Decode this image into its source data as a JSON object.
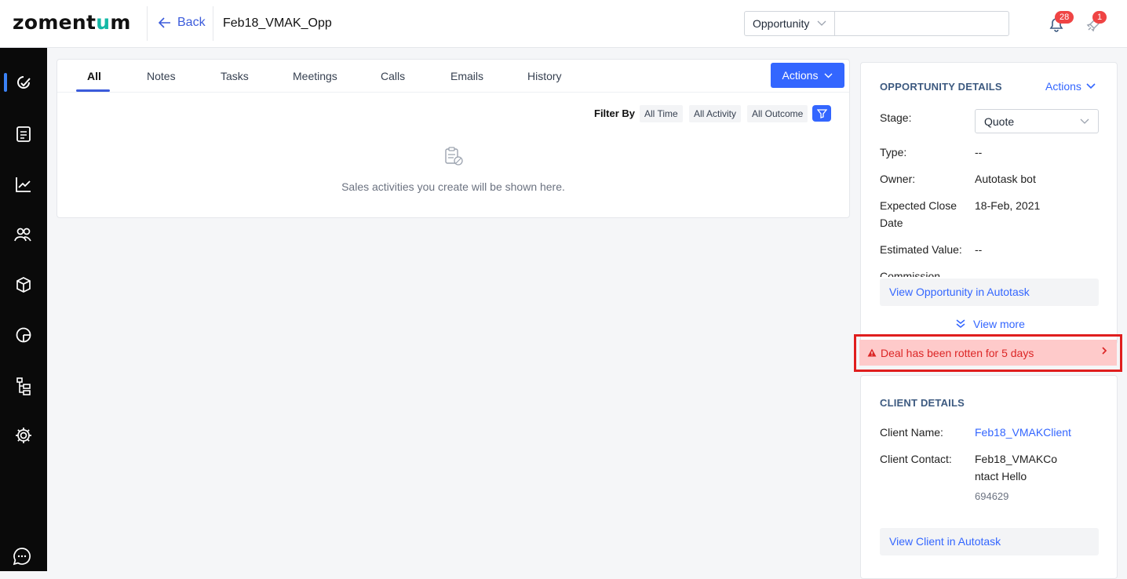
{
  "app": {
    "logo_text_a": "zoment",
    "logo_text_b": "u",
    "logo_text_c": "m"
  },
  "header": {
    "back_label": "Back",
    "title": "Feb18_VMAK_Opp",
    "search_type": "Opportunity",
    "search_value": "",
    "notifications_count": "28",
    "rocket_count": "1"
  },
  "sidebar": {
    "items": [
      {
        "icon": "dashboard-icon"
      },
      {
        "icon": "document-icon"
      },
      {
        "icon": "chart-icon"
      },
      {
        "icon": "users-icon"
      },
      {
        "icon": "box-icon"
      },
      {
        "icon": "pie-icon"
      },
      {
        "icon": "hierarchy-icon"
      },
      {
        "icon": "gear-icon"
      },
      {
        "icon": "chat-icon"
      }
    ]
  },
  "activity": {
    "tabs": [
      "All",
      "Notes",
      "Tasks",
      "Meetings",
      "Calls",
      "Emails",
      "History"
    ],
    "actions_label": "Actions",
    "filter_label": "Filter By",
    "filters": [
      "All Time",
      "All Activity",
      "All Outcome"
    ],
    "empty_text": "Sales activities you create will be shown here."
  },
  "opportunity": {
    "section_title": "OPPORTUNITY DETAILS",
    "actions_label": "Actions",
    "stage_label": "Stage:",
    "stage_value": "Quote",
    "type_label": "Type:",
    "type_value": "--",
    "owner_label": "Owner:",
    "owner_value": "Autotask bot",
    "close_label_1": "Expected Close",
    "close_label_2": "Date",
    "close_value": "18-Feb, 2021",
    "est_label": "Estimated Value:",
    "est_value": "--",
    "partial_label": "Commission",
    "view_link": "View Opportunity in Autotask",
    "view_more": "View more"
  },
  "alert": {
    "text": "Deal has been rotten for 5 days",
    "color": "#dc2626"
  },
  "client": {
    "section_title": "CLIENT DETAILS",
    "name_label": "Client Name:",
    "name_value": "Feb18_VMAKClient",
    "contact_label": "Client Contact:",
    "contact_value_1": "Feb18_VMAKCo",
    "contact_value_2": "ntact Hello",
    "contact_phone": "694629",
    "view_link": "View Client in Autotask"
  }
}
